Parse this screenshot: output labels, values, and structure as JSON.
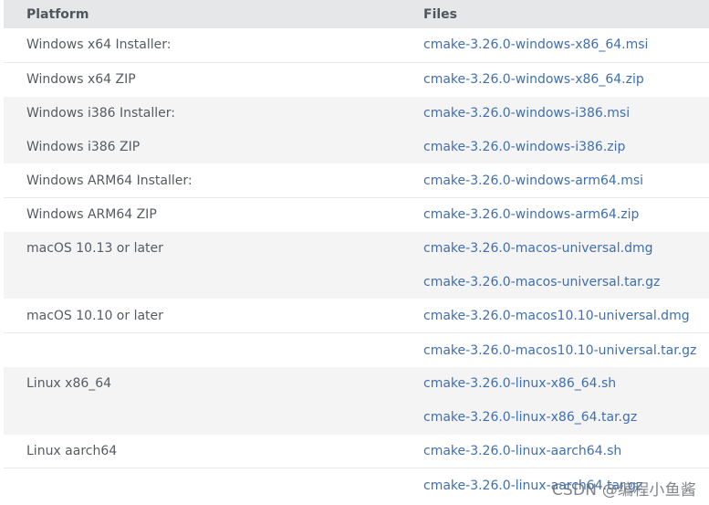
{
  "table": {
    "headers": {
      "platform": "Platform",
      "files": "Files"
    },
    "rows": [
      {
        "platform": "Windows x64 Installer:",
        "file": "cmake-3.26.0-windows-x86_64.msi"
      },
      {
        "platform": "Windows x64 ZIP",
        "file": "cmake-3.26.0-windows-x86_64.zip"
      },
      {
        "platform": "Windows i386 Installer:",
        "file": "cmake-3.26.0-windows-i386.msi"
      },
      {
        "platform": "Windows i386 ZIP",
        "file": "cmake-3.26.0-windows-i386.zip"
      },
      {
        "platform": "Windows ARM64 Installer:",
        "file": "cmake-3.26.0-windows-arm64.msi"
      },
      {
        "platform": "Windows ARM64 ZIP",
        "file": "cmake-3.26.0-windows-arm64.zip"
      },
      {
        "platform": "macOS 10.13 or later",
        "file": "cmake-3.26.0-macos-universal.dmg"
      },
      {
        "platform": "",
        "file": "cmake-3.26.0-macos-universal.tar.gz"
      },
      {
        "platform": "macOS 10.10 or later",
        "file": "cmake-3.26.0-macos10.10-universal.dmg"
      },
      {
        "platform": "",
        "file": "cmake-3.26.0-macos10.10-universal.tar.gz"
      },
      {
        "platform": "Linux x86_64",
        "file": "cmake-3.26.0-linux-x86_64.sh"
      },
      {
        "platform": "",
        "file": "cmake-3.26.0-linux-x86_64.tar.gz"
      },
      {
        "platform": "Linux aarch64",
        "file": "cmake-3.26.0-linux-aarch64.sh"
      },
      {
        "platform": "",
        "file": "cmake-3.26.0-linux-aarch64.tar.gz"
      }
    ]
  },
  "watermark": "CSDN @编程小鱼酱",
  "colors": {
    "header_bg": "#e6e7e8",
    "row_shaded": "#f4f4f5",
    "link": "#3f6fb0",
    "text": "#555b61"
  }
}
